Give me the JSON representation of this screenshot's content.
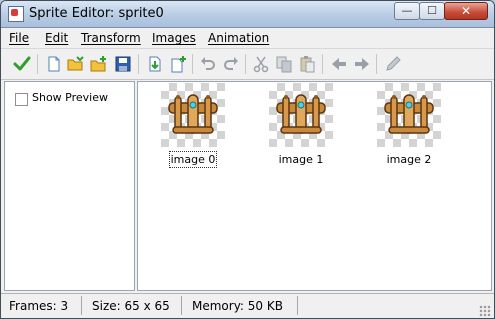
{
  "window": {
    "title": "Sprite Editor: sprite0"
  },
  "title_controls": {
    "minimize_glyph": "—",
    "maximize_glyph": "☐",
    "close_glyph": "✕"
  },
  "menu": {
    "items": [
      "File",
      "Edit",
      "Transform",
      "Images",
      "Animation"
    ]
  },
  "toolbar": {
    "icons": [
      "confirm-icon",
      "new-icon",
      "open-icon",
      "add-from-file-icon",
      "save-icon",
      "import-icon",
      "new-frame-icon",
      "undo-icon",
      "redo-icon",
      "cut-icon",
      "copy-icon",
      "paste-icon",
      "shift-left-icon",
      "shift-right-icon",
      "edit-pencil-icon"
    ],
    "colors": {
      "green": "#2e9e2e",
      "blue": "#2f5fae",
      "folder": "#f2c23a",
      "disabled": "#9aa0a8"
    }
  },
  "left_panel": {
    "show_preview_label": "Show Preview",
    "show_preview_checked": false
  },
  "frames": [
    {
      "label": "image 0",
      "selected": true
    },
    {
      "label": "image 1",
      "selected": false
    },
    {
      "label": "image 2",
      "selected": false
    }
  ],
  "status": {
    "frames": "Frames: 3",
    "size": "Size: 65 x 65",
    "memory": "Memory: 50 KB"
  }
}
